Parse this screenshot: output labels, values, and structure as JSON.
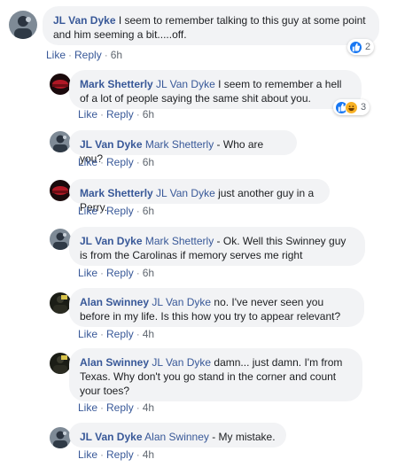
{
  "comments": [
    {
      "author": "JL Van Dyke",
      "mention": "",
      "text": " I seem to remember talking to this guy at some point and him seeming a bit.....off.",
      "time": "6h",
      "avatar": "jl-van-dyke-avatar",
      "reaction_count": "2"
    },
    {
      "author": "Mark Shetterly",
      "mention": "JL Van Dyke",
      "text": " I seem to remember a hell of a lot of people saying the same shit about you.",
      "time": "6h",
      "avatar": "mark-shetterly-avatar",
      "reaction_count": "3"
    },
    {
      "author": "JL Van Dyke",
      "mention": "Mark Shetterly",
      "text": " - Who are you?",
      "time": "6h",
      "avatar": "jl-van-dyke-avatar"
    },
    {
      "author": "Mark Shetterly",
      "mention": "JL Van Dyke",
      "text": " just another guy in a Perry.",
      "time": "6h",
      "avatar": "mark-shetterly-avatar"
    },
    {
      "author": "JL Van Dyke",
      "mention": "Mark Shetterly",
      "text": " - Ok. Well this Swinney guy is from the Carolinas if memory serves me right",
      "time": "6h",
      "avatar": "jl-van-dyke-avatar"
    },
    {
      "author": "Alan Swinney",
      "mention": "JL Van Dyke",
      "text": " no. I've never seen you before in my life. Is this how you try to appear relevant?",
      "time": "4h",
      "avatar": "alan-swinney-avatar"
    },
    {
      "author": "Alan Swinney",
      "mention": "JL Van Dyke",
      "text": " damn... just damn. I'm from Texas. Why don't you go stand in the corner and count your toes?",
      "time": "4h",
      "avatar": "alan-swinney-avatar"
    },
    {
      "author": "JL Van Dyke",
      "mention": "Alan Swinney",
      "text": " - My mistake.",
      "time": "4h",
      "avatar": "jl-van-dyke-avatar"
    }
  ],
  "actions": {
    "like": "Like",
    "reply": "Reply",
    "dot": "·"
  },
  "reactions": {
    "c0": [
      "like-icon"
    ],
    "c1": [
      "like-icon",
      "haha-icon"
    ]
  },
  "colors": {
    "link": "#385898",
    "bubble": "#f2f3f5",
    "meta": "#606770",
    "like_blue": "#1877f2",
    "haha_yellow": "#f7b125"
  }
}
